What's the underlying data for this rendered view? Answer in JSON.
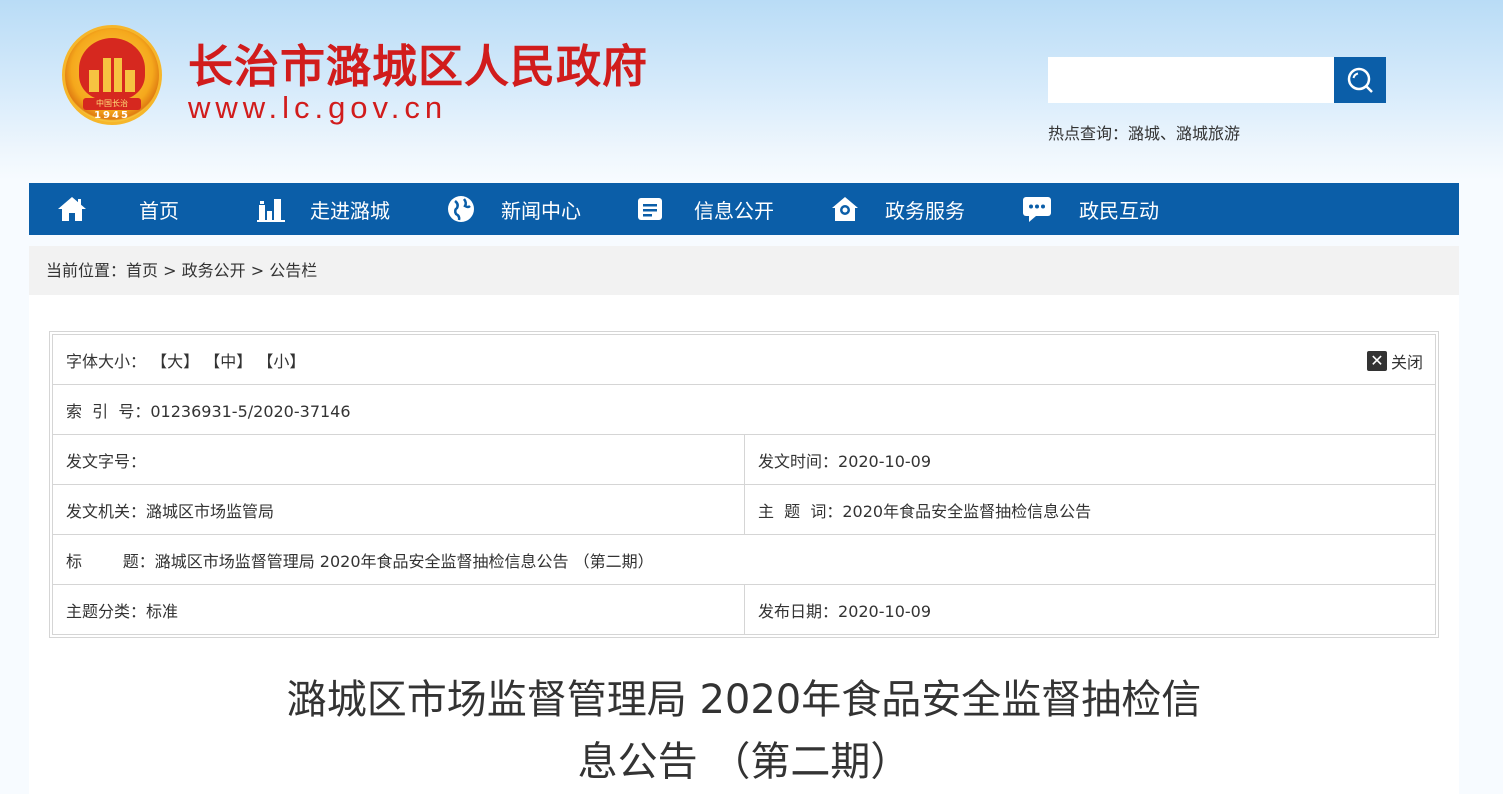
{
  "header": {
    "site_title": "长治市潞城区人民政府",
    "site_url": "www.lc.gov.cn",
    "emblem_text": "中国长治",
    "emblem_year": "1945",
    "search": {
      "placeholder": ""
    },
    "hot_label": "热点查询：",
    "hot_links": [
      "潞城",
      "潞城旅游"
    ],
    "hot_sep": "、"
  },
  "nav": {
    "items": [
      {
        "label": "首页",
        "icon": "home-icon"
      },
      {
        "label": "走进潞城",
        "icon": "buildings-icon"
      },
      {
        "label": "新闻中心",
        "icon": "globe-icon"
      },
      {
        "label": "信息公开",
        "icon": "document-icon"
      },
      {
        "label": "政务服务",
        "icon": "service-icon"
      },
      {
        "label": "政民互动",
        "icon": "chat-icon"
      }
    ]
  },
  "breadcrumb": {
    "prefix": "当前位置：",
    "items": [
      "首页",
      "政务公开",
      "公告栏"
    ],
    "sep": " > "
  },
  "meta": {
    "font_size_label": "字体大小：",
    "font_sizes": [
      "【大】",
      "【中】",
      "【小】"
    ],
    "close_label": "关闭",
    "index_label": "索  引  号：",
    "index_value": "01236931-5/2020-37146",
    "doc_no_label": "发文字号：",
    "doc_no_value": "",
    "issue_time_label": "发文时间：",
    "issue_time_value": "2020-10-09",
    "issuer_label": "发文机关：",
    "issuer_value": "潞城区市场监管局",
    "subject_label": "主  题  词：",
    "subject_value": "2020年食品安全监督抽检信息公告",
    "title_label": "标        题：",
    "title_value": "潞城区市场监督管理局 2020年食品安全监督抽检信息公告 （第二期）",
    "category_label": "主题分类：",
    "category_value": "标准",
    "publish_date_label": "发布日期：",
    "publish_date_value": "2020-10-09"
  },
  "article": {
    "title_line1": "潞城区市场监督管理局 2020年食品安全监督抽检信",
    "title_line2": "息公告 （第二期）"
  },
  "colors": {
    "brand_blue": "#0b5ea8",
    "title_red": "#d11c1c"
  }
}
